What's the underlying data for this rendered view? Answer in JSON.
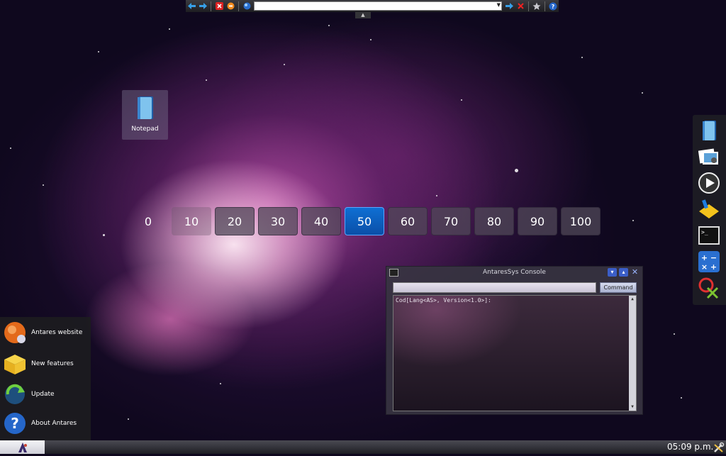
{
  "toolbar": {
    "back_icon": "arrow-left-icon",
    "forward_icon": "arrow-right-icon",
    "stop_icon": "stop-icon",
    "home_icon": "home-icon",
    "globe_icon": "globe-icon",
    "address_value": "",
    "go_icon": "go-arrow-icon",
    "close_icon": "close-icon",
    "favorites_icon": "star-icon",
    "help_icon": "help-icon"
  },
  "desktop": {
    "icons": [
      {
        "label": "Notepad",
        "icon": "notepad-icon"
      }
    ]
  },
  "zoom_bar": {
    "steps": [
      "0",
      "10",
      "20",
      "30",
      "40",
      "50",
      "60",
      "70",
      "80",
      "90",
      "100"
    ],
    "selected": "50",
    "accent_color": "#0a5fc2"
  },
  "dock": {
    "items": [
      "notepad-icon",
      "photos-icon",
      "media-player-icon",
      "paint-icon",
      "terminal-icon",
      "calculator-icon",
      "search-icon"
    ]
  },
  "console": {
    "title": "AntaresSys Console",
    "command_value": "",
    "command_button": "Command",
    "output": "Cod[Lang<AS>, Version<1.0>]:"
  },
  "start_menu": {
    "items": [
      {
        "label": "Antares website",
        "icon": "globe-icon"
      },
      {
        "label": "New features",
        "icon": "package-icon"
      },
      {
        "label": "Update",
        "icon": "update-icon"
      },
      {
        "label": "About Antares",
        "icon": "help-icon"
      }
    ]
  },
  "taskbar": {
    "start_icon": "antares-logo-icon",
    "clock": "05:09 p.m.",
    "tools_icon": "tools-icon"
  }
}
